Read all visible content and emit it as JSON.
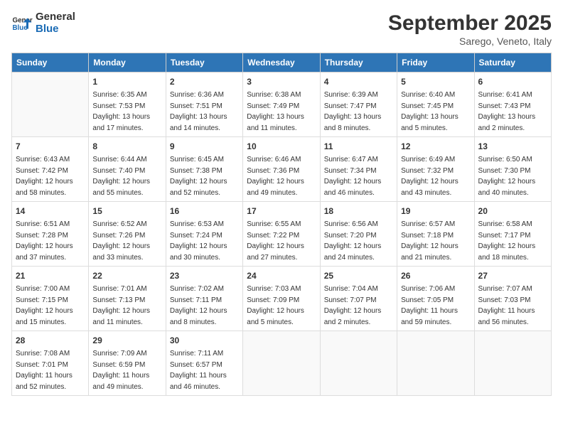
{
  "header": {
    "logo_line1": "General",
    "logo_line2": "Blue",
    "month_title": "September 2025",
    "subtitle": "Sarego, Veneto, Italy"
  },
  "weekdays": [
    "Sunday",
    "Monday",
    "Tuesday",
    "Wednesday",
    "Thursday",
    "Friday",
    "Saturday"
  ],
  "weeks": [
    [
      {
        "day": "",
        "info": ""
      },
      {
        "day": "1",
        "info": "Sunrise: 6:35 AM\nSunset: 7:53 PM\nDaylight: 13 hours\nand 17 minutes."
      },
      {
        "day": "2",
        "info": "Sunrise: 6:36 AM\nSunset: 7:51 PM\nDaylight: 13 hours\nand 14 minutes."
      },
      {
        "day": "3",
        "info": "Sunrise: 6:38 AM\nSunset: 7:49 PM\nDaylight: 13 hours\nand 11 minutes."
      },
      {
        "day": "4",
        "info": "Sunrise: 6:39 AM\nSunset: 7:47 PM\nDaylight: 13 hours\nand 8 minutes."
      },
      {
        "day": "5",
        "info": "Sunrise: 6:40 AM\nSunset: 7:45 PM\nDaylight: 13 hours\nand 5 minutes."
      },
      {
        "day": "6",
        "info": "Sunrise: 6:41 AM\nSunset: 7:43 PM\nDaylight: 13 hours\nand 2 minutes."
      }
    ],
    [
      {
        "day": "7",
        "info": "Sunrise: 6:43 AM\nSunset: 7:42 PM\nDaylight: 12 hours\nand 58 minutes."
      },
      {
        "day": "8",
        "info": "Sunrise: 6:44 AM\nSunset: 7:40 PM\nDaylight: 12 hours\nand 55 minutes."
      },
      {
        "day": "9",
        "info": "Sunrise: 6:45 AM\nSunset: 7:38 PM\nDaylight: 12 hours\nand 52 minutes."
      },
      {
        "day": "10",
        "info": "Sunrise: 6:46 AM\nSunset: 7:36 PM\nDaylight: 12 hours\nand 49 minutes."
      },
      {
        "day": "11",
        "info": "Sunrise: 6:47 AM\nSunset: 7:34 PM\nDaylight: 12 hours\nand 46 minutes."
      },
      {
        "day": "12",
        "info": "Sunrise: 6:49 AM\nSunset: 7:32 PM\nDaylight: 12 hours\nand 43 minutes."
      },
      {
        "day": "13",
        "info": "Sunrise: 6:50 AM\nSunset: 7:30 PM\nDaylight: 12 hours\nand 40 minutes."
      }
    ],
    [
      {
        "day": "14",
        "info": "Sunrise: 6:51 AM\nSunset: 7:28 PM\nDaylight: 12 hours\nand 37 minutes."
      },
      {
        "day": "15",
        "info": "Sunrise: 6:52 AM\nSunset: 7:26 PM\nDaylight: 12 hours\nand 33 minutes."
      },
      {
        "day": "16",
        "info": "Sunrise: 6:53 AM\nSunset: 7:24 PM\nDaylight: 12 hours\nand 30 minutes."
      },
      {
        "day": "17",
        "info": "Sunrise: 6:55 AM\nSunset: 7:22 PM\nDaylight: 12 hours\nand 27 minutes."
      },
      {
        "day": "18",
        "info": "Sunrise: 6:56 AM\nSunset: 7:20 PM\nDaylight: 12 hours\nand 24 minutes."
      },
      {
        "day": "19",
        "info": "Sunrise: 6:57 AM\nSunset: 7:18 PM\nDaylight: 12 hours\nand 21 minutes."
      },
      {
        "day": "20",
        "info": "Sunrise: 6:58 AM\nSunset: 7:17 PM\nDaylight: 12 hours\nand 18 minutes."
      }
    ],
    [
      {
        "day": "21",
        "info": "Sunrise: 7:00 AM\nSunset: 7:15 PM\nDaylight: 12 hours\nand 15 minutes."
      },
      {
        "day": "22",
        "info": "Sunrise: 7:01 AM\nSunset: 7:13 PM\nDaylight: 12 hours\nand 11 minutes."
      },
      {
        "day": "23",
        "info": "Sunrise: 7:02 AM\nSunset: 7:11 PM\nDaylight: 12 hours\nand 8 minutes."
      },
      {
        "day": "24",
        "info": "Sunrise: 7:03 AM\nSunset: 7:09 PM\nDaylight: 12 hours\nand 5 minutes."
      },
      {
        "day": "25",
        "info": "Sunrise: 7:04 AM\nSunset: 7:07 PM\nDaylight: 12 hours\nand 2 minutes."
      },
      {
        "day": "26",
        "info": "Sunrise: 7:06 AM\nSunset: 7:05 PM\nDaylight: 11 hours\nand 59 minutes."
      },
      {
        "day": "27",
        "info": "Sunrise: 7:07 AM\nSunset: 7:03 PM\nDaylight: 11 hours\nand 56 minutes."
      }
    ],
    [
      {
        "day": "28",
        "info": "Sunrise: 7:08 AM\nSunset: 7:01 PM\nDaylight: 11 hours\nand 52 minutes."
      },
      {
        "day": "29",
        "info": "Sunrise: 7:09 AM\nSunset: 6:59 PM\nDaylight: 11 hours\nand 49 minutes."
      },
      {
        "day": "30",
        "info": "Sunrise: 7:11 AM\nSunset: 6:57 PM\nDaylight: 11 hours\nand 46 minutes."
      },
      {
        "day": "",
        "info": ""
      },
      {
        "day": "",
        "info": ""
      },
      {
        "day": "",
        "info": ""
      },
      {
        "day": "",
        "info": ""
      }
    ]
  ]
}
